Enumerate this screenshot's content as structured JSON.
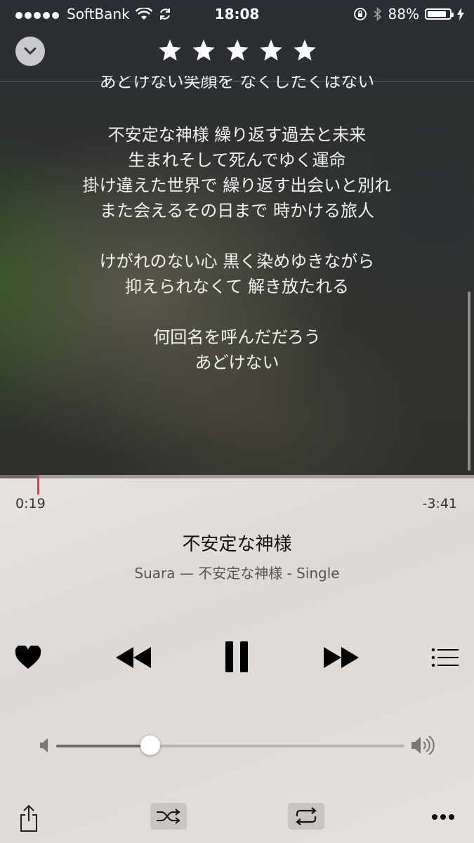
{
  "status_bar": {
    "carrier": "SoftBank",
    "time": "18:08",
    "battery_percent": "88%",
    "battery_level": 0.88,
    "signal_dots": 5
  },
  "header": {
    "rating": 5,
    "rating_max": 5,
    "collapse_icon": "chevron-down-icon"
  },
  "lyrics": {
    "partial_line": "あどけない笑顔を なくしたくはない",
    "stanzas": [
      [
        "不安定な神様 繰り返す過去と未来",
        "生まれそして死んでゆく運命",
        "掛け違えた世界で 繰り返す出会いと別れ",
        "また会えるその日まで 時かける旅人"
      ],
      [
        "けがれのない心 黒く染めゆきながら",
        "抑えられなくて 解き放たれる"
      ],
      [
        "何回名を呼んだだろう",
        "あどけない"
      ]
    ]
  },
  "playback": {
    "elapsed": "0:19",
    "remaining": "-3:41",
    "progress": 0.08
  },
  "track": {
    "title": "不安定な神様",
    "subtitle": "Suara — 不安定な神様 - Single"
  },
  "controls": {
    "love_icon": "heart-icon",
    "rewind_icon": "rewind-icon",
    "pause_icon": "pause-icon",
    "forward_icon": "fast-forward-icon",
    "queue_icon": "list-icon"
  },
  "volume": {
    "level": 0.27
  },
  "bottom_bar": {
    "share_icon": "share-icon",
    "shuffle_icon": "shuffle-icon",
    "repeat_icon": "repeat-icon",
    "more_icon": "more-icon"
  },
  "colors": {
    "accent_playhead": "#ff2d55",
    "toggle_bg": "#c9c5c1"
  }
}
